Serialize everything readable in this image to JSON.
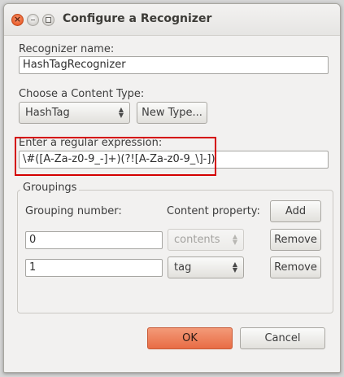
{
  "window": {
    "title": "Configure a Recognizer",
    "close_glyph": "×"
  },
  "recognizer_name": {
    "label": "Recognizer name:",
    "value": "HashTagRecognizer"
  },
  "content_type": {
    "label": "Choose a Content Type:",
    "selected": "HashTag",
    "new_type_label": "New Type..."
  },
  "regex": {
    "label": "Enter a regular expression:",
    "value": "\\#([A-Za-z0-9_-]+)(?![A-Za-z0-9_\\]-])",
    "highlight_color": "#d40000"
  },
  "groupings": {
    "title": "Groupings",
    "grouping_number_label": "Grouping number:",
    "content_property_label": "Content property:",
    "add_label": "Add",
    "rows": [
      {
        "number": "0",
        "property": "contents",
        "property_disabled": true,
        "remove_label": "Remove"
      },
      {
        "number": "1",
        "property": "tag",
        "property_disabled": false,
        "remove_label": "Remove"
      }
    ]
  },
  "footer": {
    "ok_label": "OK",
    "cancel_label": "Cancel"
  },
  "icons": {
    "close": "close-icon",
    "minimize": "minimize-icon",
    "maximize": "maximize-icon",
    "combo": "up-down-arrows-icon"
  },
  "colors": {
    "accent": "#e86c45",
    "window_bg": "#f2f1f0"
  }
}
